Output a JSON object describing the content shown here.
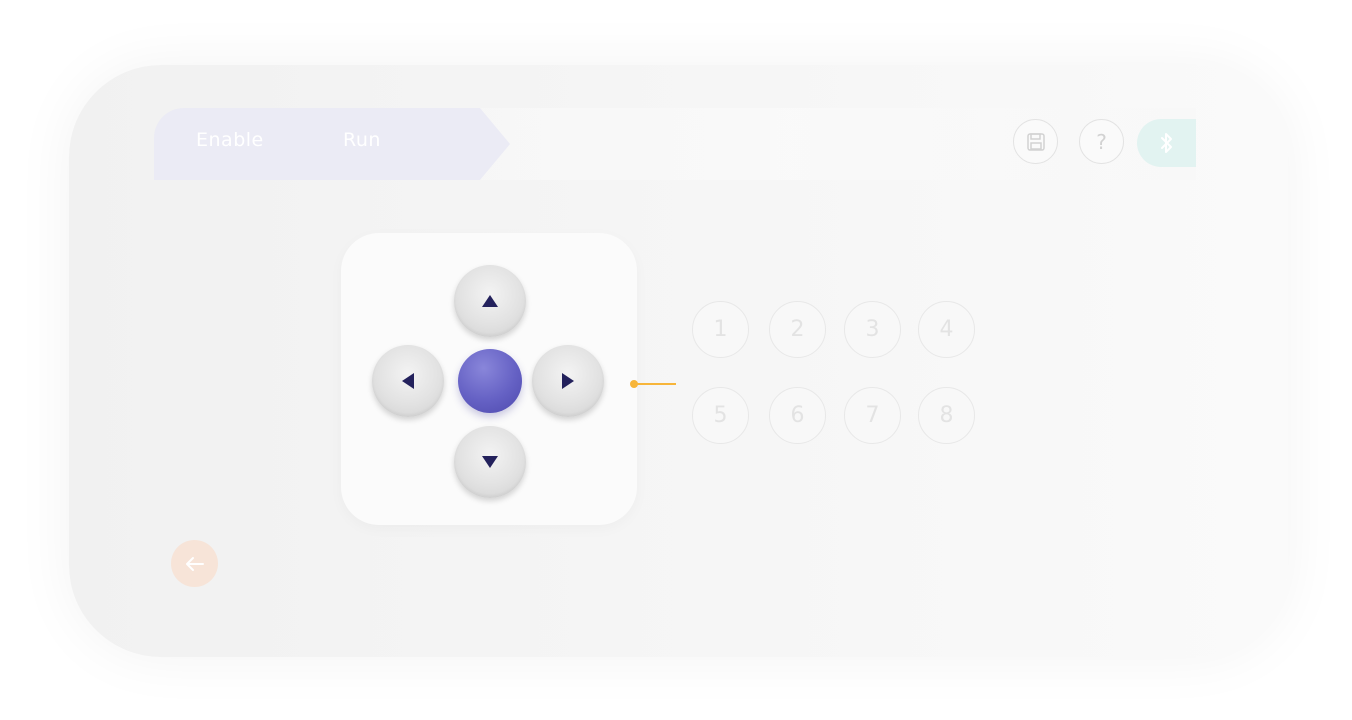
{
  "modes": {
    "enable_label": "Enable",
    "run_label": "Run"
  },
  "toolbar": {
    "save_icon": "save-icon",
    "help_label": "?",
    "bluetooth_icon": "bluetooth-icon"
  },
  "dpad": {
    "up_icon": "triangle-up-icon",
    "down_icon": "triangle-down-icon",
    "left_icon": "triangle-left-icon",
    "right_icon": "triangle-right-icon",
    "center_icon": "center-joystick"
  },
  "number_buttons": [
    "1",
    "2",
    "3",
    "4",
    "5",
    "6",
    "7",
    "8"
  ],
  "back": {
    "icon": "arrow-left-icon"
  },
  "colors": {
    "accent": "#6561c4",
    "arrow": "#23215c",
    "connector": "#f7b53a",
    "mode_pill": "#ebebf5",
    "bluetooth_bg": "#e2f3f1",
    "back_bg": "#f7e4d8"
  }
}
